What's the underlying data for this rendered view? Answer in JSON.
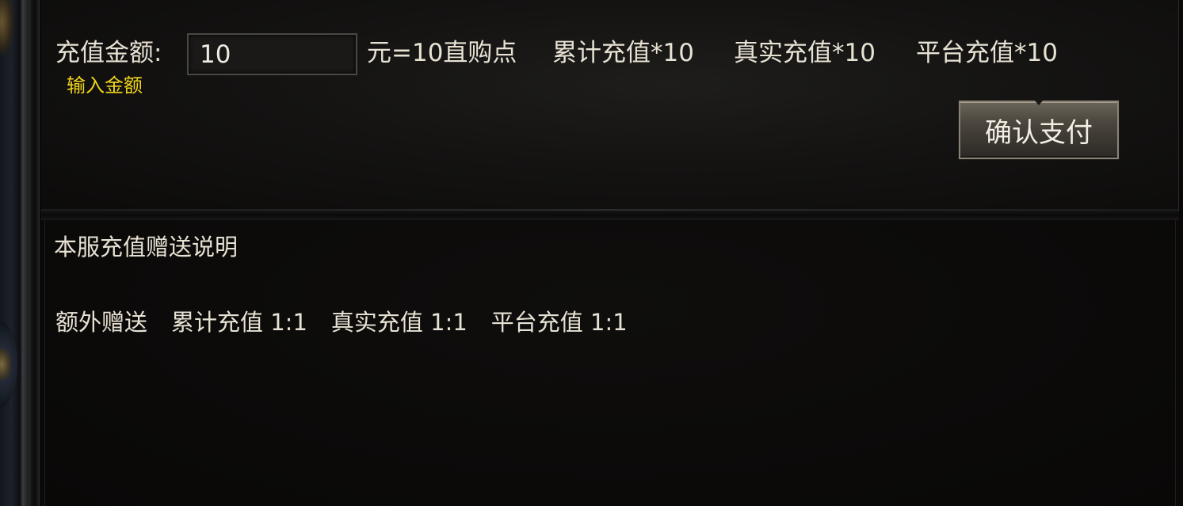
{
  "recharge": {
    "amount_label": "充值金额:",
    "amount_value": "10",
    "amount_hint": "输入金额",
    "rate_text": "元=10直购点",
    "cumulative_text": "累计充值*10",
    "real_text": "真实充值*10",
    "platform_text": "平台充值*10",
    "confirm_label": "确认支付"
  },
  "description": {
    "title": "本服充值赠送说明",
    "bonus_label": "额外赠送",
    "bonus_cumulative": "累计充值 1:1",
    "bonus_real": "真实充值 1:1",
    "bonus_platform": "平台充值 1:1"
  },
  "colors": {
    "hint_text": "#f1d51a",
    "body_text": "#e8e2d4",
    "background": "#0a0908"
  }
}
